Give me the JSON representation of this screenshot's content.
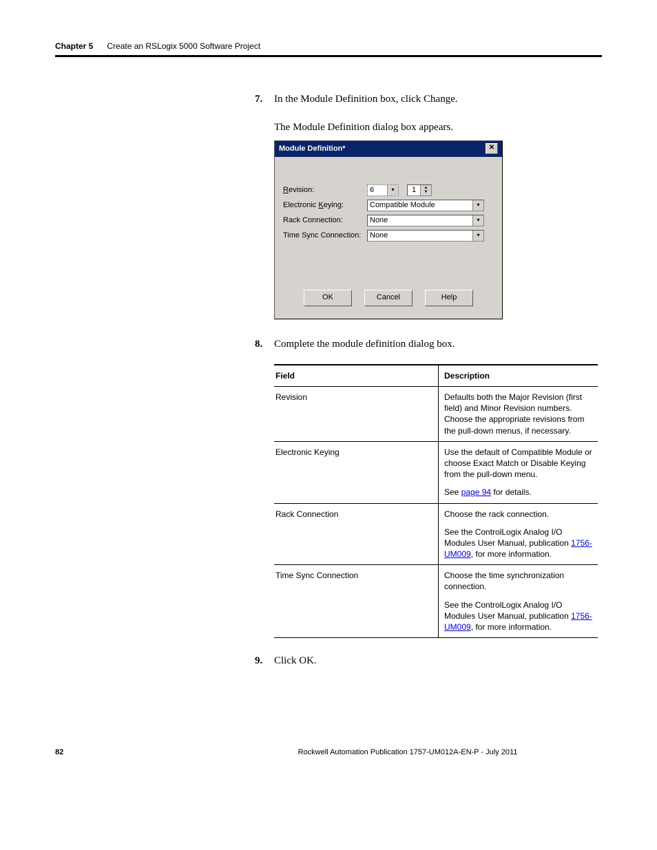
{
  "header": {
    "chapter_label": "Chapter 5",
    "chapter_title": "Create an RSLogix 5000 Software Project"
  },
  "steps": {
    "s7_num": "7.",
    "s7_text": "In the Module Definition box, click Change.",
    "s7_caption": "The Module Definition dialog box appears.",
    "s8_num": "8.",
    "s8_text": "Complete the module definition dialog box.",
    "s9_num": "9.",
    "s9_text": "Click OK."
  },
  "dialog": {
    "title": "Module Definition*",
    "close_glyph": "✕",
    "labels": {
      "revision_pre": "R",
      "revision_post": "evision:",
      "ek_pre": "Electronic ",
      "ek_mid": "K",
      "ek_post": "eying:",
      "rack": "Rack Connection:",
      "timesync": "Time Sync Connection:"
    },
    "values": {
      "major_rev": "6",
      "minor_rev": "1",
      "keying": "Compatible Module",
      "rack": "None",
      "timesync": "None"
    },
    "buttons": {
      "ok": "OK",
      "cancel": "Cancel",
      "help": "Help"
    },
    "arrow": "▾",
    "spin_up": "▲",
    "spin_down": "▼"
  },
  "table": {
    "head_field": "Field",
    "head_desc": "Description",
    "rows": [
      {
        "field": "Revision",
        "p1": "Defaults both the Major Revision (first field) and Minor Revision numbers. Choose the appropriate revisions from the pull-down menus, if necessary."
      },
      {
        "field": "Electronic Keying",
        "p1": "Use the default of Compatible Module or choose Exact Match or Disable Keying from the pull-down menu.",
        "p2_pre": "See ",
        "p2_link": "page 94",
        "p2_post": " for details."
      },
      {
        "field": "Rack Connection",
        "p1": "Choose the rack connection.",
        "p2_pre": "See the ControlLogix Analog I/O Modules User Manual, publication ",
        "p2_link": "1756-UM009",
        "p2_post": ", for more information."
      },
      {
        "field": "Time Sync Connection",
        "p1": "Choose the time synchronization connection.",
        "p2_pre": "See the ControlLogix Analog I/O Modules User Manual, publication ",
        "p2_link": "1756-UM009",
        "p2_post": ", for more information."
      }
    ]
  },
  "footer": {
    "page": "82",
    "pub": "Rockwell Automation Publication 1757-UM012A-EN-P - July 2011"
  }
}
